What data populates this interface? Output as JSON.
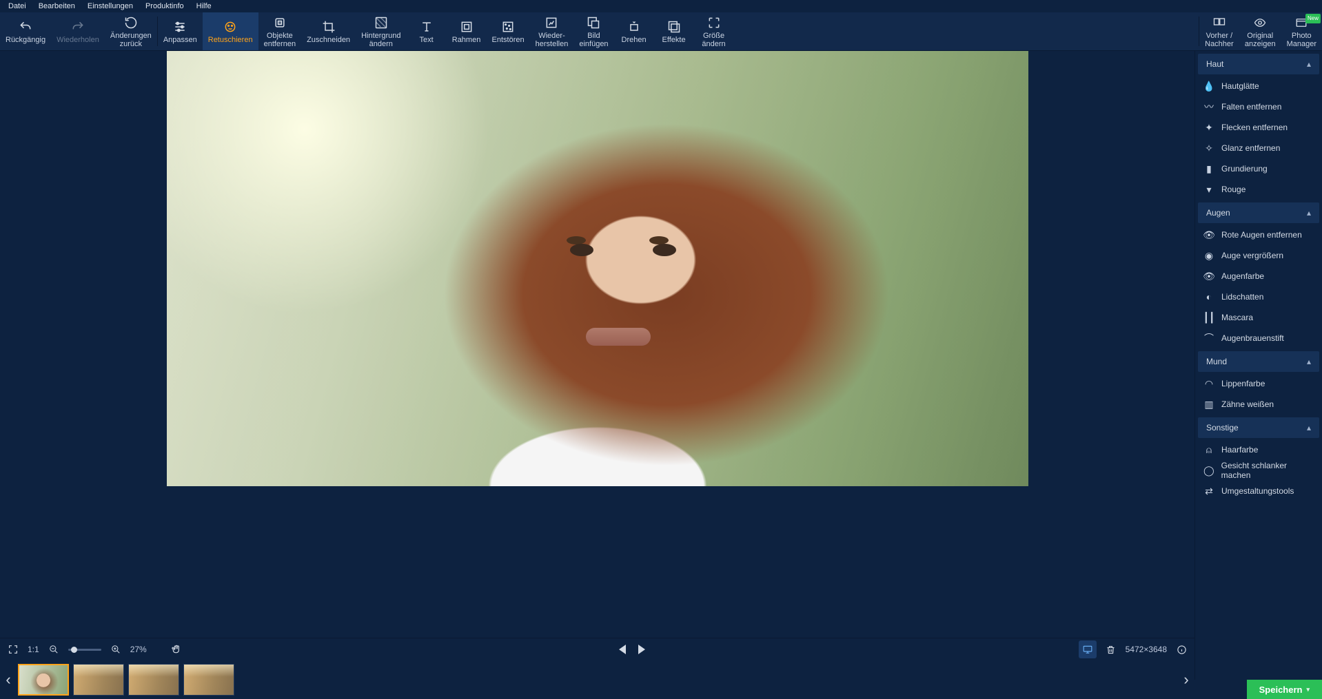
{
  "menubar": [
    "Datei",
    "Bearbeiten",
    "Einstellungen",
    "Produktinfo",
    "Hilfe"
  ],
  "toolbar": {
    "history": [
      {
        "id": "undo",
        "label": "Rückgängig",
        "disabled": false
      },
      {
        "id": "redo",
        "label": "Wiederholen",
        "disabled": true
      },
      {
        "id": "revert",
        "label": "Änderungen\nzurück",
        "disabled": false
      }
    ],
    "tools": [
      {
        "id": "adjust",
        "label": "Anpassen"
      },
      {
        "id": "retouch",
        "label": "Retuschieren",
        "active": true
      },
      {
        "id": "remove-obj",
        "label": "Objekte\nentfernen"
      },
      {
        "id": "crop",
        "label": "Zuschneiden"
      },
      {
        "id": "bg-change",
        "label": "Hintergrund\nändern"
      },
      {
        "id": "text",
        "label": "Text"
      },
      {
        "id": "frame",
        "label": "Rahmen"
      },
      {
        "id": "denoise",
        "label": "Entstören"
      },
      {
        "id": "restore",
        "label": "Wieder-\nherstellen"
      },
      {
        "id": "insert-img",
        "label": "Bild\neinfügen"
      },
      {
        "id": "rotate",
        "label": "Drehen"
      },
      {
        "id": "effects",
        "label": "Effekte"
      },
      {
        "id": "resize",
        "label": "Größe\nändern"
      }
    ],
    "right": [
      {
        "id": "before-after",
        "label": "Vorher /\nNachher"
      },
      {
        "id": "view-orig",
        "label": "Original\nanzeigen"
      },
      {
        "id": "photo-mgr",
        "label": "Photo\nManager",
        "badge": "New"
      }
    ]
  },
  "statusbar": {
    "fit_label": "1:1",
    "zoom_percent": "27%",
    "dimensions": "5472×3648"
  },
  "save_label": "Speichern",
  "side_panel": {
    "sections": [
      {
        "id": "skin",
        "title": "Haut",
        "items": [
          {
            "id": "smooth",
            "label": "Hautglätte"
          },
          {
            "id": "wrinkles",
            "label": "Falten entfernen"
          },
          {
            "id": "blemish",
            "label": "Flecken entfernen"
          },
          {
            "id": "shine",
            "label": "Glanz entfernen"
          },
          {
            "id": "foundation",
            "label": "Grundierung"
          },
          {
            "id": "blush",
            "label": "Rouge"
          }
        ]
      },
      {
        "id": "eyes",
        "title": "Augen",
        "items": [
          {
            "id": "redeye",
            "label": "Rote Augen entfernen"
          },
          {
            "id": "enlarge",
            "label": "Auge vergrößern"
          },
          {
            "id": "eyecolor",
            "label": "Augenfarbe"
          },
          {
            "id": "eyeshadow",
            "label": "Lidschatten"
          },
          {
            "id": "mascara",
            "label": "Mascara"
          },
          {
            "id": "browpencil",
            "label": "Augenbrauenstift"
          }
        ]
      },
      {
        "id": "mouth",
        "title": "Mund",
        "items": [
          {
            "id": "lipcolor",
            "label": "Lippenfarbe"
          },
          {
            "id": "whiten",
            "label": "Zähne weißen"
          }
        ]
      },
      {
        "id": "other",
        "title": "Sonstige",
        "items": [
          {
            "id": "haircolor",
            "label": "Haarfarbe"
          },
          {
            "id": "slimface",
            "label": "Gesicht schlanker machen"
          },
          {
            "id": "reshape",
            "label": "Umgestaltungstools"
          }
        ]
      }
    ]
  },
  "filmstrip": {
    "count": 4,
    "selected": 0
  }
}
